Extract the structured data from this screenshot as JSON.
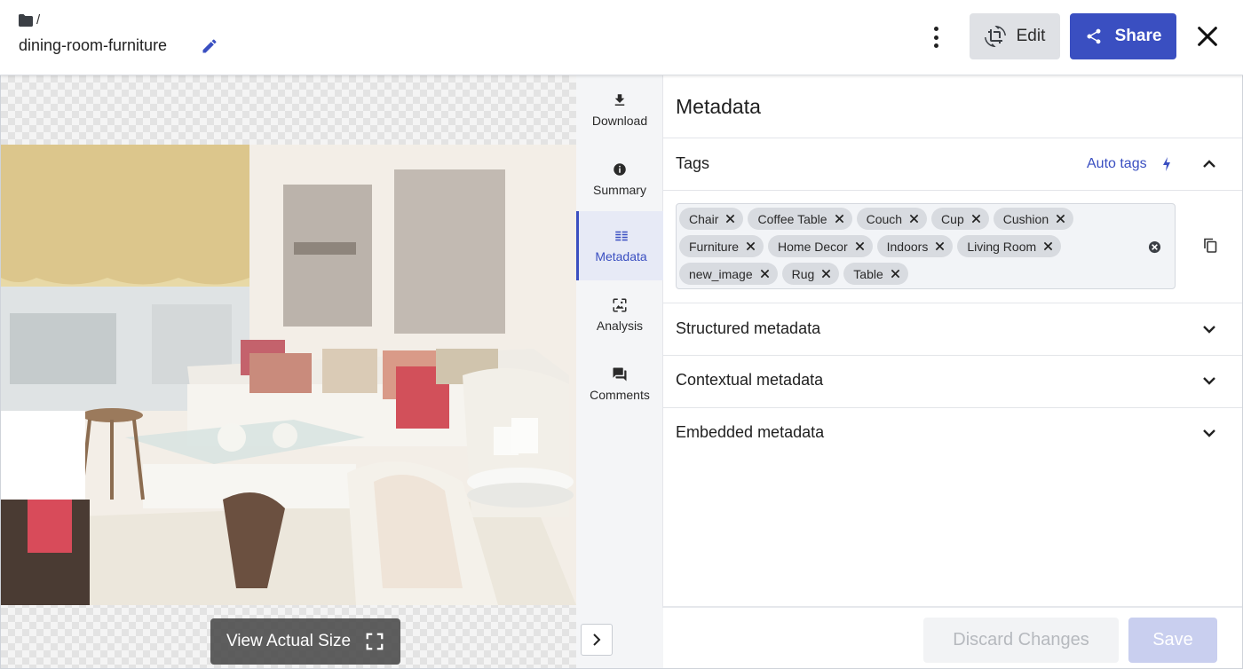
{
  "header": {
    "breadcrumb_separator": "/",
    "asset_title": "dining-room-furniture",
    "edit_label": "Edit",
    "share_label": "Share"
  },
  "preview": {
    "view_actual_size_label": "View Actual Size"
  },
  "sidenav": {
    "items": [
      {
        "label": "Download",
        "icon": "download-icon"
      },
      {
        "label": "Summary",
        "icon": "info-icon"
      },
      {
        "label": "Metadata",
        "icon": "list-icon",
        "active": true
      },
      {
        "label": "Analysis",
        "icon": "analysis-icon"
      },
      {
        "label": "Comments",
        "icon": "comments-icon"
      }
    ]
  },
  "panel": {
    "title": "Metadata",
    "tags_section": {
      "label": "Tags",
      "auto_tags_label": "Auto tags",
      "tags": [
        "Chair",
        "Coffee Table",
        "Couch",
        "Cup",
        "Cushion",
        "Furniture",
        "Home Decor",
        "Indoors",
        "Living Room",
        "new_image",
        "Rug",
        "Table"
      ]
    },
    "sections": [
      {
        "label": "Structured metadata"
      },
      {
        "label": "Contextual metadata"
      },
      {
        "label": "Embedded metadata"
      }
    ]
  },
  "footer": {
    "discard_label": "Discard Changes",
    "save_label": "Save"
  },
  "colors": {
    "accent": "#3a4fc1",
    "save_disabled": "#c9cfef"
  }
}
